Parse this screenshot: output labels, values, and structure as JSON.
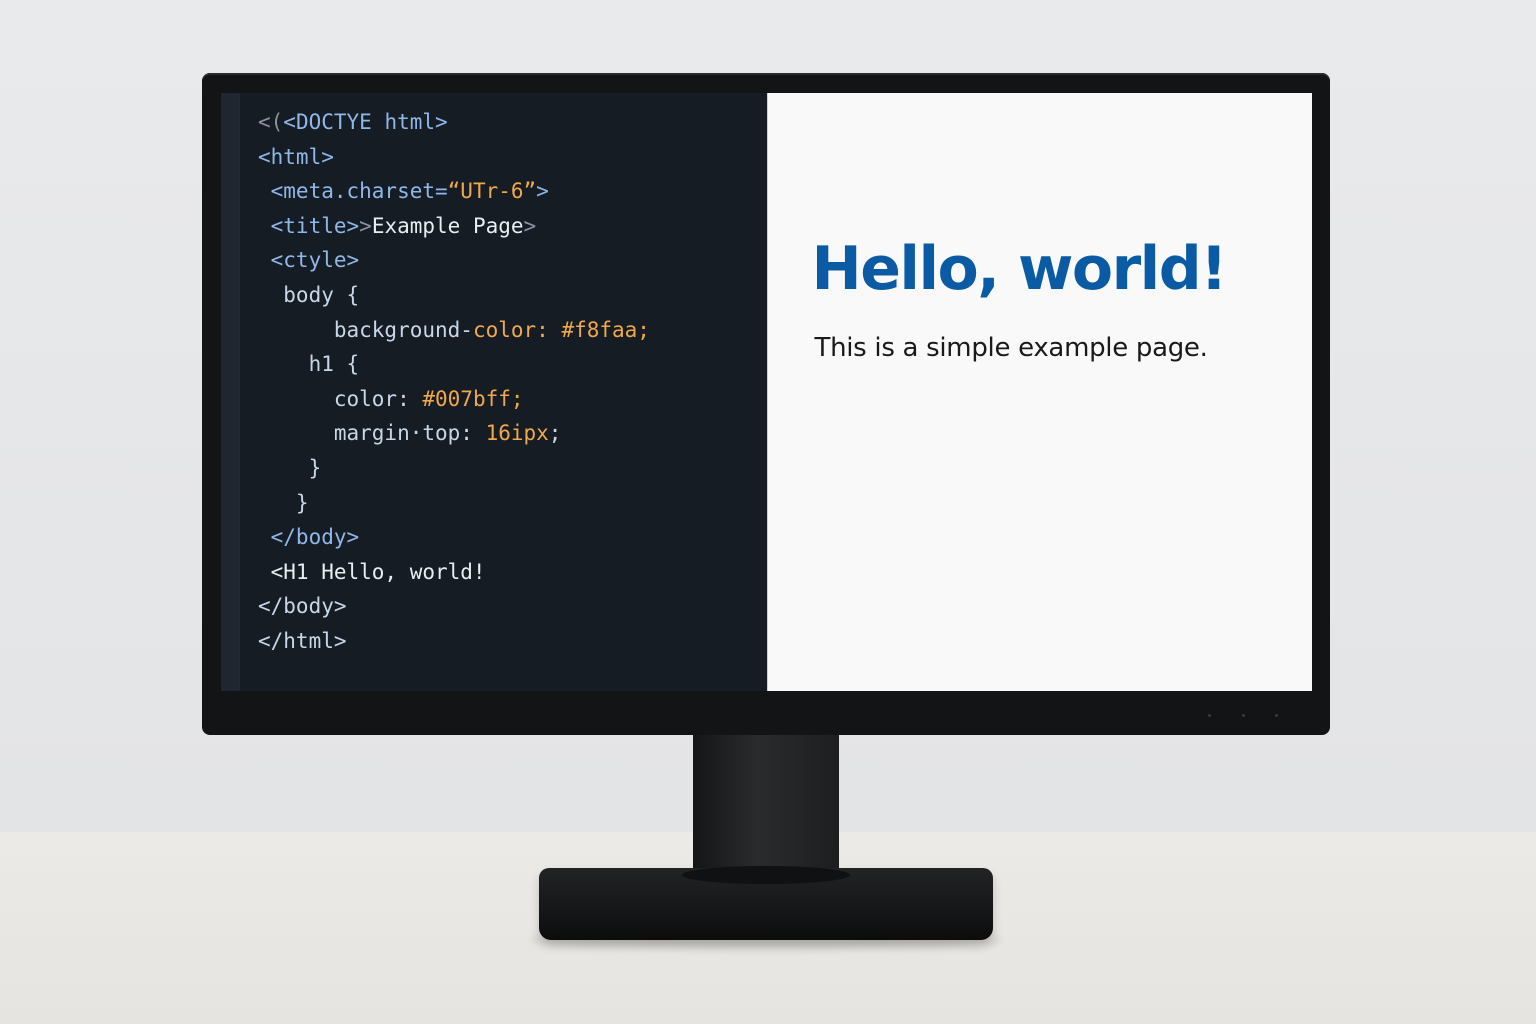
{
  "editor": {
    "lines": [
      [
        {
          "t": "<(",
          "c": "#8a93a0"
        },
        {
          "t": "<DOCTYE html>",
          "c": "#8fb8e8"
        }
      ],
      [
        {
          "t": "<html>",
          "c": "#8fb8e8"
        }
      ],
      [
        {
          "t": " <meta.charset=",
          "c": "#8fb8e8"
        },
        {
          "t": "“UTr-6”",
          "c": "#f0a94a"
        },
        {
          "t": ">",
          "c": "#8fb8e8"
        }
      ],
      [
        {
          "t": " <title>",
          "c": "#8fb8e8"
        },
        {
          "t": ">",
          "c": "#8a93a0"
        },
        {
          "t": "Example Page",
          "c": "#e8edf2"
        },
        {
          "t": ">",
          "c": "#8a93a0"
        }
      ],
      [
        {
          "t": " <ctyle>",
          "c": "#8fb8e8"
        }
      ],
      [
        {
          "t": "  body {",
          "c": "#c8d6e6"
        }
      ],
      [
        {
          "t": "      background-",
          "c": "#c8d6e6"
        },
        {
          "t": "color: ",
          "c": "#f0a94a"
        },
        {
          "t": "#f8faa;",
          "c": "#f0a94a"
        }
      ],
      [
        {
          "t": "    h1 {",
          "c": "#c8d6e6"
        }
      ],
      [
        {
          "t": "      color: ",
          "c": "#c8d6e6"
        },
        {
          "t": "#007bff;",
          "c": "#f0a94a"
        }
      ],
      [
        {
          "t": "      margin·top: ",
          "c": "#c8d6e6"
        },
        {
          "t": "16ipx",
          "c": "#f0a94a"
        },
        {
          "t": ";",
          "c": "#c8d6e6"
        }
      ],
      [
        {
          "t": "    }",
          "c": "#c8d6e6"
        }
      ],
      [
        {
          "t": "   }",
          "c": "#c8d6e6"
        }
      ],
      [
        {
          "t": " </body>",
          "c": "#8fb8e8"
        }
      ],
      [
        {
          "t": " <H1 Hello, world!",
          "c": "#e8edf2"
        }
      ],
      [
        {
          "t": "</body>",
          "c": "#c8d6e6"
        }
      ],
      [
        {
          "t": "</html>",
          "c": "#c8d6e6"
        }
      ]
    ]
  },
  "preview": {
    "heading": "Hello, world!",
    "text": "This is a simple example page."
  },
  "colors": {
    "editor_bg": "#161c24",
    "preview_bg": "#f9f9f9",
    "heading": "#0a5aa4"
  }
}
